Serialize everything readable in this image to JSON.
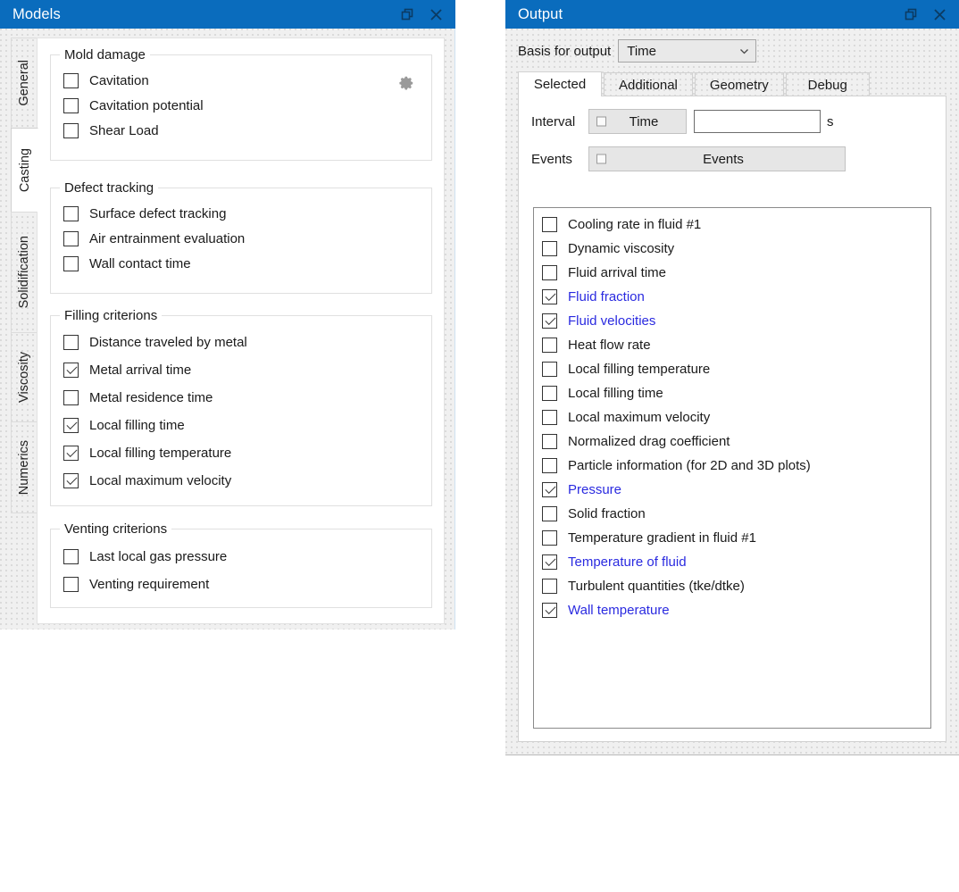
{
  "colors": {
    "titlebar_blue": "#0a6cbd",
    "selected_item_text": "#2a2ae0",
    "window_text": "#1a1a1a"
  },
  "models_window": {
    "title": "Models",
    "restore_icon": "restore-window-icon",
    "close_icon": "close-icon",
    "side_tabs": [
      {
        "label": "General",
        "active": false
      },
      {
        "label": "Casting",
        "active": true
      },
      {
        "label": "Solidification",
        "active": false
      },
      {
        "label": "Viscosity",
        "active": false
      },
      {
        "label": "Numerics",
        "active": false
      }
    ],
    "groups": [
      {
        "legend": "Mold damage",
        "gear_icon": "gear-icon",
        "items": [
          {
            "label": "Cavitation",
            "checked": false
          },
          {
            "label": "Cavitation potential",
            "checked": false
          },
          {
            "label": "Shear Load",
            "checked": false
          }
        ]
      },
      {
        "legend": "Defect tracking",
        "items": [
          {
            "label": "Surface defect tracking",
            "checked": false
          },
          {
            "label": "Air entrainment evaluation",
            "checked": false
          },
          {
            "label": "Wall contact time",
            "checked": false
          }
        ]
      },
      {
        "legend": "Filling criterions",
        "items": [
          {
            "label": "Distance traveled by metal",
            "checked": false
          },
          {
            "label": "Metal arrival time",
            "checked": true
          },
          {
            "label": "Metal residence time",
            "checked": false
          },
          {
            "label": "Local filling time",
            "checked": true
          },
          {
            "label": "Local filling temperature",
            "checked": true
          },
          {
            "label": "Local maximum velocity",
            "checked": true
          }
        ]
      },
      {
        "legend": "Venting criterions",
        "items": [
          {
            "label": "Last local gas pressure",
            "checked": false
          },
          {
            "label": "Venting requirement",
            "checked": false
          }
        ]
      }
    ]
  },
  "output_window": {
    "title": "Output",
    "restore_icon": "restore-window-icon",
    "close_icon": "close-icon",
    "basis": {
      "label": "Basis for output",
      "value": "Time",
      "options": [
        "Time"
      ],
      "chevron_icon": "chevron-down-icon"
    },
    "tabs": [
      {
        "label": "Selected",
        "active": true
      },
      {
        "label": "Additional",
        "active": false
      },
      {
        "label": "Geometry",
        "active": false
      },
      {
        "label": "Debug",
        "active": false
      }
    ],
    "interval": {
      "label": "Interval",
      "button_label": "Time",
      "checked": false,
      "value": "",
      "placeholder": "",
      "unit": "s"
    },
    "events": {
      "label": "Events",
      "button_label": "Events",
      "checked": false
    },
    "quantities": [
      {
        "label": "Cooling rate in fluid #1",
        "checked": false
      },
      {
        "label": "Dynamic viscosity",
        "checked": false
      },
      {
        "label": "Fluid arrival time",
        "checked": false
      },
      {
        "label": "Fluid fraction",
        "checked": true
      },
      {
        "label": "Fluid velocities",
        "checked": true
      },
      {
        "label": "Heat flow rate",
        "checked": false
      },
      {
        "label": "Local filling temperature",
        "checked": false
      },
      {
        "label": "Local filling time",
        "checked": false
      },
      {
        "label": "Local maximum velocity",
        "checked": false
      },
      {
        "label": "Normalized drag coefficient",
        "checked": false
      },
      {
        "label": "Particle information (for 2D and 3D plots)",
        "checked": false
      },
      {
        "label": "Pressure",
        "checked": true
      },
      {
        "label": "Solid fraction",
        "checked": false
      },
      {
        "label": "Temperature gradient in fluid #1",
        "checked": false
      },
      {
        "label": "Temperature of fluid",
        "checked": true
      },
      {
        "label": "Turbulent quantities (tke/dtke)",
        "checked": false
      },
      {
        "label": "Wall temperature",
        "checked": true
      }
    ]
  }
}
